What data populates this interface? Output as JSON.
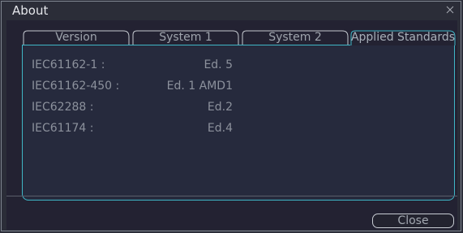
{
  "window": {
    "title": "About"
  },
  "tabs": [
    {
      "label": "Version",
      "active": false
    },
    {
      "label": "System 1",
      "active": false
    },
    {
      "label": "System 2",
      "active": false
    },
    {
      "label": "Applied Standards",
      "active": true
    }
  ],
  "standards": [
    {
      "name": "IEC61162-1 :",
      "edition": "Ed. 5"
    },
    {
      "name": "IEC61162-450 :",
      "edition": "Ed. 1 AMD1"
    },
    {
      "name": "IEC62288 :",
      "edition": "Ed.2"
    },
    {
      "name": "IEC61174 :",
      "edition": "Ed.4"
    }
  ],
  "buttons": {
    "close_label": "Close"
  },
  "colors": {
    "accent": "#3fb6c6",
    "background": "#2b2d38",
    "panel": "#262a3d"
  }
}
